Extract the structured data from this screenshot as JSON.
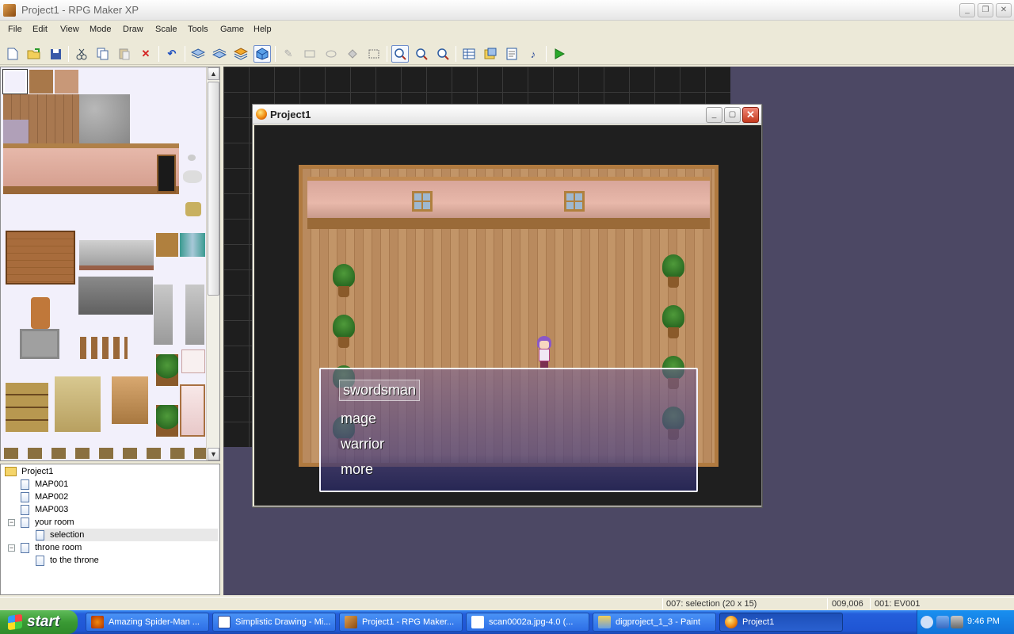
{
  "window": {
    "title": "Project1 - RPG Maker XP",
    "minimize": "_",
    "maximize": "▢",
    "restore": "❐"
  },
  "menu": [
    "File",
    "Edit",
    "View",
    "Mode",
    "Draw",
    "Scale",
    "Tools",
    "Game",
    "Help"
  ],
  "toolbar": {
    "icons": [
      "new-project-icon",
      "open-project-icon",
      "save-icon",
      "cut-icon",
      "copy-icon",
      "paste-icon",
      "delete-icon",
      "undo-icon",
      "layer1-icon",
      "layer2-icon",
      "layer3-icon",
      "events-layer-icon",
      "pencil-icon",
      "rectangle-icon",
      "ellipse-icon",
      "fill-icon",
      "select-icon",
      "zoom-1-1-icon",
      "zoom-1-2-icon",
      "zoom-1-4-icon",
      "database-icon",
      "materialbase-icon",
      "script-editor-icon",
      "sound-test-icon",
      "playtest-icon"
    ],
    "active": [
      "events-layer-icon",
      "zoom-1-1-icon"
    ]
  },
  "tree": {
    "root": "Project1",
    "nodes": [
      {
        "label": "MAP001"
      },
      {
        "label": "MAP002"
      },
      {
        "label": "MAP003"
      },
      {
        "label": "your room"
      },
      {
        "label": "selection"
      },
      {
        "label": "throne room"
      },
      {
        "label": "to the throne"
      }
    ],
    "selected": "selection"
  },
  "game_window": {
    "title": "Project1",
    "choices": [
      "swordsman",
      "mage",
      "warrior",
      "more"
    ],
    "selected_choice": "swordsman"
  },
  "status": {
    "map_info": "007: selection (20 x 15)",
    "coords": "009,006",
    "event": "001: EV001"
  },
  "taskbar": {
    "start": "start",
    "tasks": [
      {
        "label": "Amazing Spider-Man ..."
      },
      {
        "label": "Simplistic Drawing - Mi..."
      },
      {
        "label": "Project1 - RPG Maker..."
      },
      {
        "label": "scan0002a.jpg-4.0 (..."
      },
      {
        "label": "digproject_1_3 - Paint"
      },
      {
        "label": "Project1"
      }
    ],
    "active_task": "Project1",
    "clock": "9:46 PM"
  },
  "colors": {
    "map_background": "#4c4864",
    "taskbar_blue": "#245edb",
    "start_green": "#3a9a34",
    "choice_text": "#ffffff"
  }
}
